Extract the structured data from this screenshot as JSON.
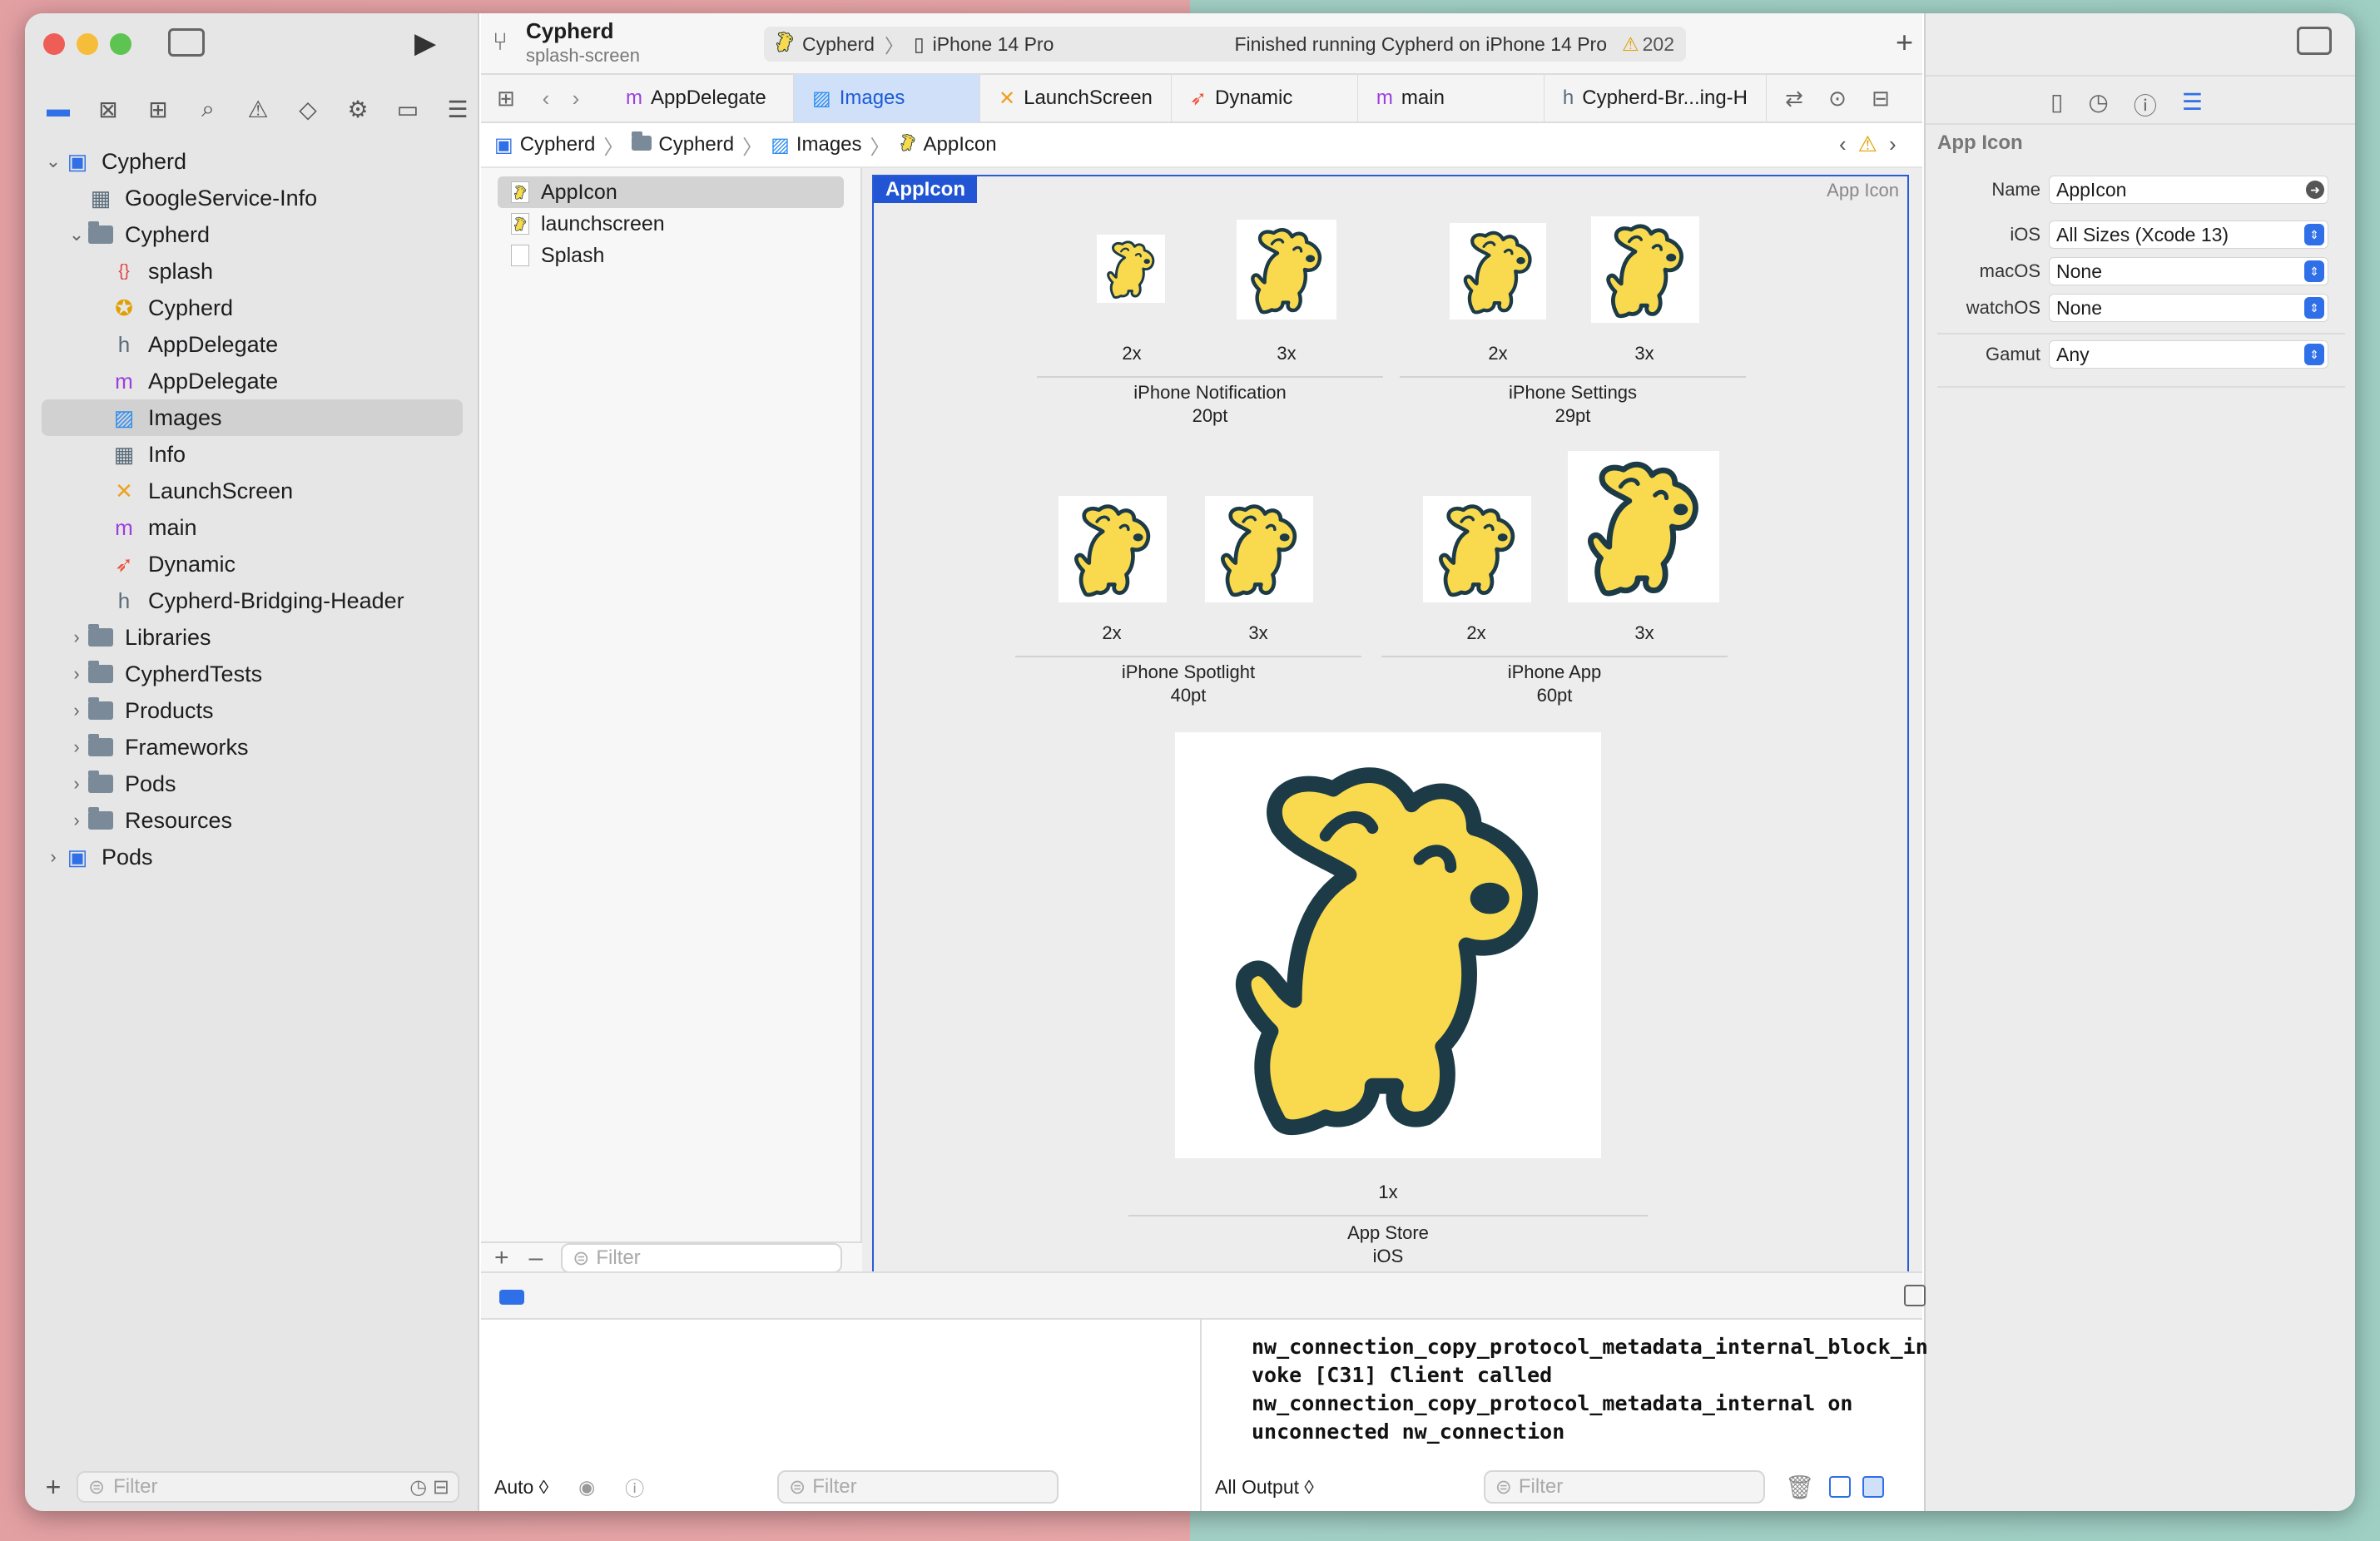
{
  "window": {
    "traffic_colors": [
      "#ee5e57",
      "#f6bd3b",
      "#5ec451"
    ]
  },
  "toolbar": {
    "project_name": "Cypherd",
    "branch": "splash-screen",
    "scheme": "Cypherd",
    "device": "iPhone 14 Pro",
    "status": "Finished running Cypherd on iPhone 14 Pro",
    "warning_count": "202",
    "add_label": "+"
  },
  "navigator": {
    "items": [
      {
        "label": "Cypherd",
        "icon": "project-icon",
        "level": 0,
        "chevron": "open"
      },
      {
        "label": "GoogleService-Info",
        "icon": "plist-icon",
        "level": 1,
        "chevron": ""
      },
      {
        "label": "Cypherd",
        "icon": "folder-icon",
        "level": 1,
        "chevron": "open"
      },
      {
        "label": "splash",
        "icon": "json-icon",
        "level": 2,
        "chevron": ""
      },
      {
        "label": "Cypherd",
        "icon": "entitlements-icon",
        "level": 2,
        "chevron": ""
      },
      {
        "label": "AppDelegate",
        "icon": "header-icon",
        "level": 2,
        "chevron": ""
      },
      {
        "label": "AppDelegate",
        "icon": "objc-icon",
        "level": 2,
        "chevron": ""
      },
      {
        "label": "Images",
        "icon": "asset-catalog-icon",
        "level": 2,
        "chevron": "",
        "selected": true
      },
      {
        "label": "Info",
        "icon": "plist-icon",
        "level": 2,
        "chevron": ""
      },
      {
        "label": "LaunchScreen",
        "icon": "storyboard-icon",
        "level": 2,
        "chevron": ""
      },
      {
        "label": "main",
        "icon": "objc-icon",
        "level": 2,
        "chevron": ""
      },
      {
        "label": "Dynamic",
        "icon": "swift-icon",
        "level": 2,
        "chevron": ""
      },
      {
        "label": "Cypherd-Bridging-Header",
        "icon": "header-icon",
        "level": 2,
        "chevron": ""
      },
      {
        "label": "Libraries",
        "icon": "folder-icon",
        "level": 1,
        "chevron": "closed"
      },
      {
        "label": "CypherdTests",
        "icon": "folder-icon",
        "level": 1,
        "chevron": "closed"
      },
      {
        "label": "Products",
        "icon": "folder-icon",
        "level": 1,
        "chevron": "closed"
      },
      {
        "label": "Frameworks",
        "icon": "folder-icon",
        "level": 1,
        "chevron": "closed"
      },
      {
        "label": "Pods",
        "icon": "folder-icon",
        "level": 1,
        "chevron": "closed"
      },
      {
        "label": "Resources",
        "icon": "folder-icon",
        "level": 1,
        "chevron": "closed"
      },
      {
        "label": "Pods",
        "icon": "project-icon",
        "level": 0,
        "chevron": "closed"
      }
    ],
    "filter_placeholder": "Filter"
  },
  "tabs": [
    {
      "label": "AppDelegate",
      "icon": "objc-icon",
      "active": false
    },
    {
      "label": "Images",
      "icon": "asset-catalog-icon",
      "active": true
    },
    {
      "label": "LaunchScreen",
      "icon": "storyboard-icon",
      "active": false
    },
    {
      "label": "Dynamic",
      "icon": "swift-icon",
      "active": false
    },
    {
      "label": "main",
      "icon": "objc-icon",
      "active": false
    },
    {
      "label": "Cypherd-Br...ing-H",
      "icon": "header-icon",
      "active": false
    }
  ],
  "breadcrumb": [
    "Cypherd",
    "Cypherd",
    "Images",
    "AppIcon"
  ],
  "assets": {
    "items": [
      {
        "label": "AppIcon",
        "selected": true
      },
      {
        "label": "launchscreen",
        "selected": false
      },
      {
        "label": "Splash",
        "selected": false
      }
    ],
    "filter_placeholder": "Filter"
  },
  "appicon": {
    "title": "AppIcon",
    "kind": "App Icon",
    "groups": [
      {
        "name": "iPhone Notification",
        "size": "20pt",
        "scales": [
          "2x",
          "3x"
        ]
      },
      {
        "name": "iPhone Settings",
        "size": "29pt",
        "scales": [
          "2x",
          "3x"
        ]
      },
      {
        "name": "iPhone Spotlight",
        "size": "40pt",
        "scales": [
          "2x",
          "3x"
        ]
      },
      {
        "name": "iPhone App",
        "size": "60pt",
        "scales": [
          "2x",
          "3x"
        ]
      },
      {
        "name": "App Store",
        "size": "iOS",
        "scales": [
          "1x"
        ]
      }
    ]
  },
  "inspector": {
    "section": "App Icon",
    "name_label": "Name",
    "name_value": "AppIcon",
    "ios_label": "iOS",
    "ios_value": "All Sizes (Xcode 13)",
    "macos_label": "macOS",
    "macos_value": "None",
    "watchos_label": "watchOS",
    "watchos_value": "None",
    "gamut_label": "Gamut",
    "gamut_value": "Any"
  },
  "debug": {
    "auto_label": "Auto ◊",
    "filter_placeholder": "Filter",
    "output_label": "All Output ◊",
    "console_lines": [
      "nw_connection_copy_protocol_metadata_internal_block_in",
      "voke [C31] Client called",
      "nw_connection_copy_protocol_metadata_internal on",
      "unconnected nw_connection"
    ]
  },
  "colors": {
    "accent": "#2255d3",
    "dog_fill": "#f9d94e",
    "dog_stroke": "#1c3b47"
  }
}
